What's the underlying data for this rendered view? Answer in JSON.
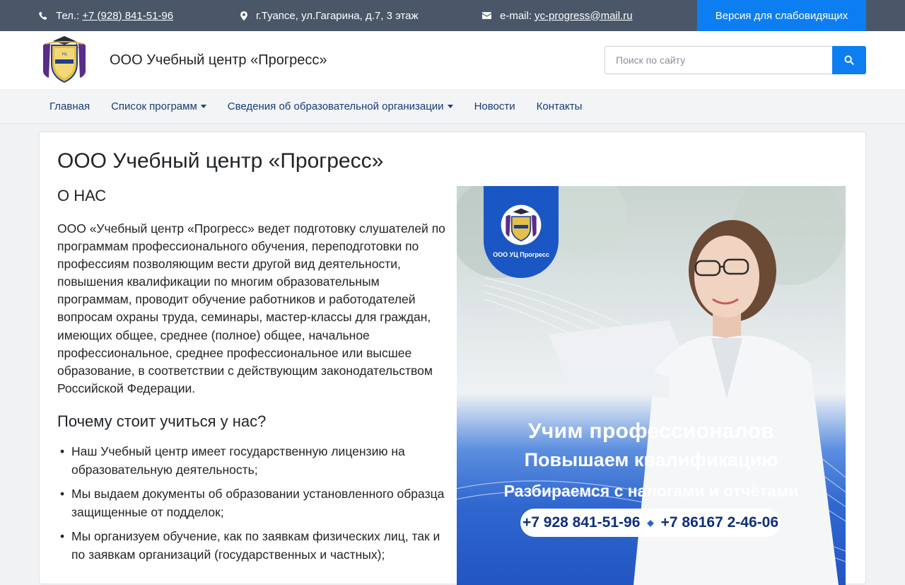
{
  "topbar": {
    "phone_prefix": "Тел.:",
    "phone": "+7 (928) 841-51-96",
    "address": "г.Туапсе, ул.Гагарина, д.7, 3 этаж",
    "email_prefix": "e-mail:",
    "email": "yc-progress@mail.ru",
    "accessibility_label": "Версия для слабовидящих"
  },
  "header": {
    "site_title": "ООО Учебный центр «Прогресс»",
    "search_placeholder": "Поиск по сайту"
  },
  "nav": {
    "items": [
      {
        "label": "Главная",
        "dropdown": false
      },
      {
        "label": "Список программ",
        "dropdown": true
      },
      {
        "label": "Сведения об образовательной организации",
        "dropdown": true
      },
      {
        "label": "Новости",
        "dropdown": false
      },
      {
        "label": "Контакты",
        "dropdown": false
      }
    ]
  },
  "main": {
    "title": "ООО Учебный центр «Прогресс»",
    "about_heading": "О НАС",
    "about_text": "ООО «Учебный центр «Прогресс» ведет подготовку слушателей по программам профессионального обучения, переподготовки по профессиям позволяющим вести другой вид деятельности, повышения квалификации по многим образовательным программам, проводит обучение работников и работодателей вопросам охраны труда, семинары, мастер-классы для граждан, имеющих общее, среднее (полное) общее, начальное профессиональное, среднее профессиональное или высшее образование, в соответствии с действующим законодательством Российской Федерации.",
    "why_heading": "Почему стоит учиться у нас?",
    "why_items": [
      "Наш Учебный центр имеет государственную лицензию на образовательную деятельность;",
      "Мы выдаем документы об образовании установленного образца защищенные от подделок;",
      "Мы организуем обучение, как по заявкам физических лиц, так и по заявкам организаций (государственных и частных);"
    ]
  },
  "banner": {
    "org_label": "ООО УЦ Прогресс",
    "line1": "Учим профессионалов",
    "line2": "Повышаем квалификацию",
    "line3": "Разбираемся с налогами и отчётами",
    "phone1": "+7 928 841-51-96",
    "phone2": "+7 86167 2-46-06"
  },
  "icons": {
    "phone": "phone-icon",
    "address": "map-marker-icon",
    "email": "envelope-icon",
    "search": "search-icon"
  },
  "colors": {
    "topbar_bg": "#4a5769",
    "accent_blue": "#0d7ef2",
    "nav_text": "#163c7a"
  }
}
